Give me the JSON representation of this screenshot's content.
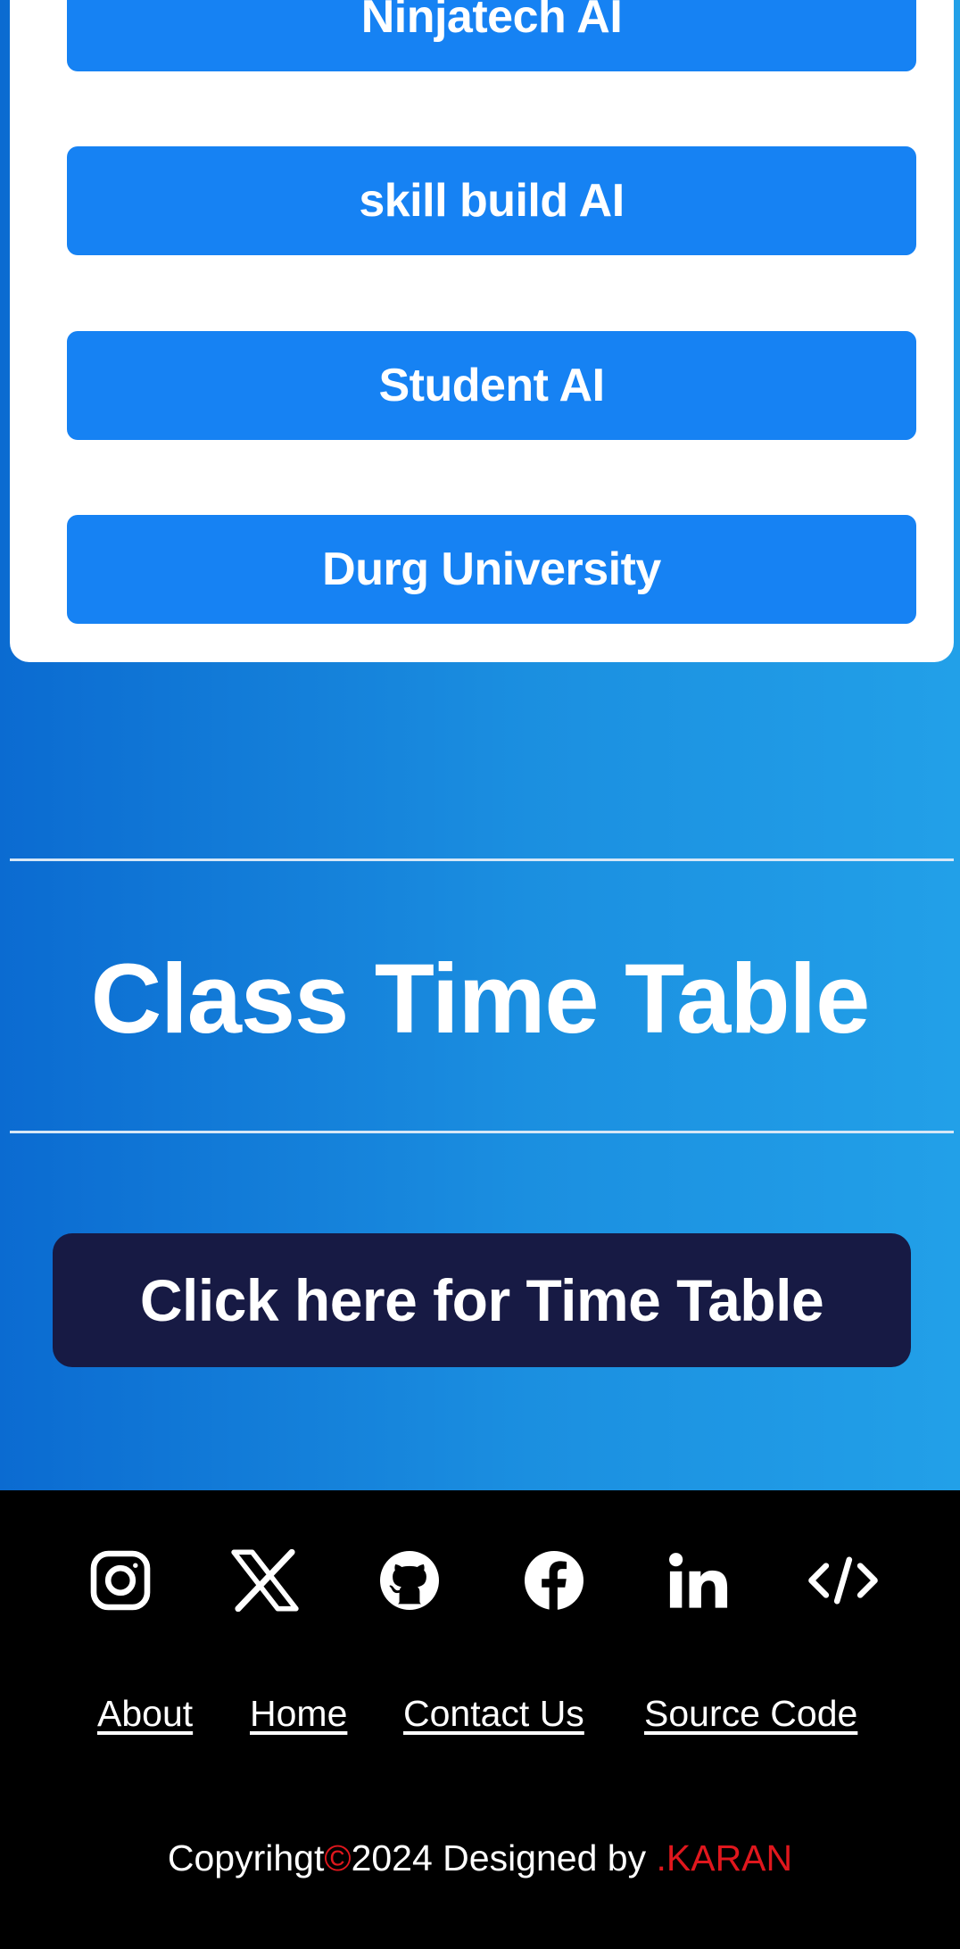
{
  "links": [
    {
      "label": "Ninjatech AI"
    },
    {
      "label": "skill build AI"
    },
    {
      "label": "Student AI"
    },
    {
      "label": "Durg University"
    }
  ],
  "timetable": {
    "title": "Class Time Table",
    "button_label": "Click here for Time Table"
  },
  "footer": {
    "social": [
      {
        "name": "instagram-icon"
      },
      {
        "name": "x-icon"
      },
      {
        "name": "github-icon"
      },
      {
        "name": "facebook-icon"
      },
      {
        "name": "linkedin-icon"
      },
      {
        "name": "code-icon"
      }
    ],
    "nav": {
      "about": "About",
      "home": "Home",
      "contact": "Contact Us",
      "source": "Source Code"
    },
    "copyright": {
      "prefix": "Copyrihgt",
      "symbol": "©",
      "text": "2024 Designed by ",
      "author": ".KARAN"
    }
  },
  "colors": {
    "link_button": "#1682f3",
    "timetable_button": "#171a44",
    "accent_red": "#e0171d",
    "background_gradient_start": "#0b6bd1",
    "background_gradient_end": "#22a0e8"
  }
}
